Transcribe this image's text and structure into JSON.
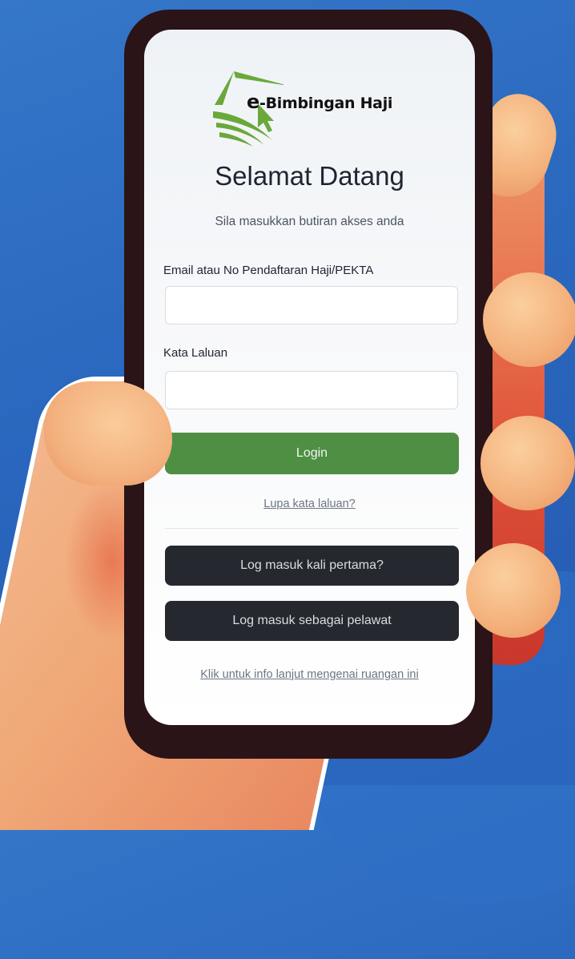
{
  "app": {
    "logo_text": "-Bimbingan Haji",
    "logo_e": "e"
  },
  "login": {
    "title": "Selamat Datang",
    "subtitle": "Sila masukkan butiran akses anda",
    "email_label": "Email atau No Pendaftaran Haji/PEKTA",
    "email_value": "",
    "password_label": "Kata Laluan",
    "password_value": "",
    "login_button": "Login",
    "forgot_link": "Lupa kata laluan?",
    "first_login_button": "Log masuk kali pertama?",
    "guest_button": "Log masuk sebagai pelawat",
    "info_link": "Klik untuk info lanjut mengenai ruangan ini"
  },
  "colors": {
    "background": "#2a67be",
    "accent_green": "#4f8f44",
    "dark_button": "#25292f",
    "logo_green": "#6aa83a"
  }
}
